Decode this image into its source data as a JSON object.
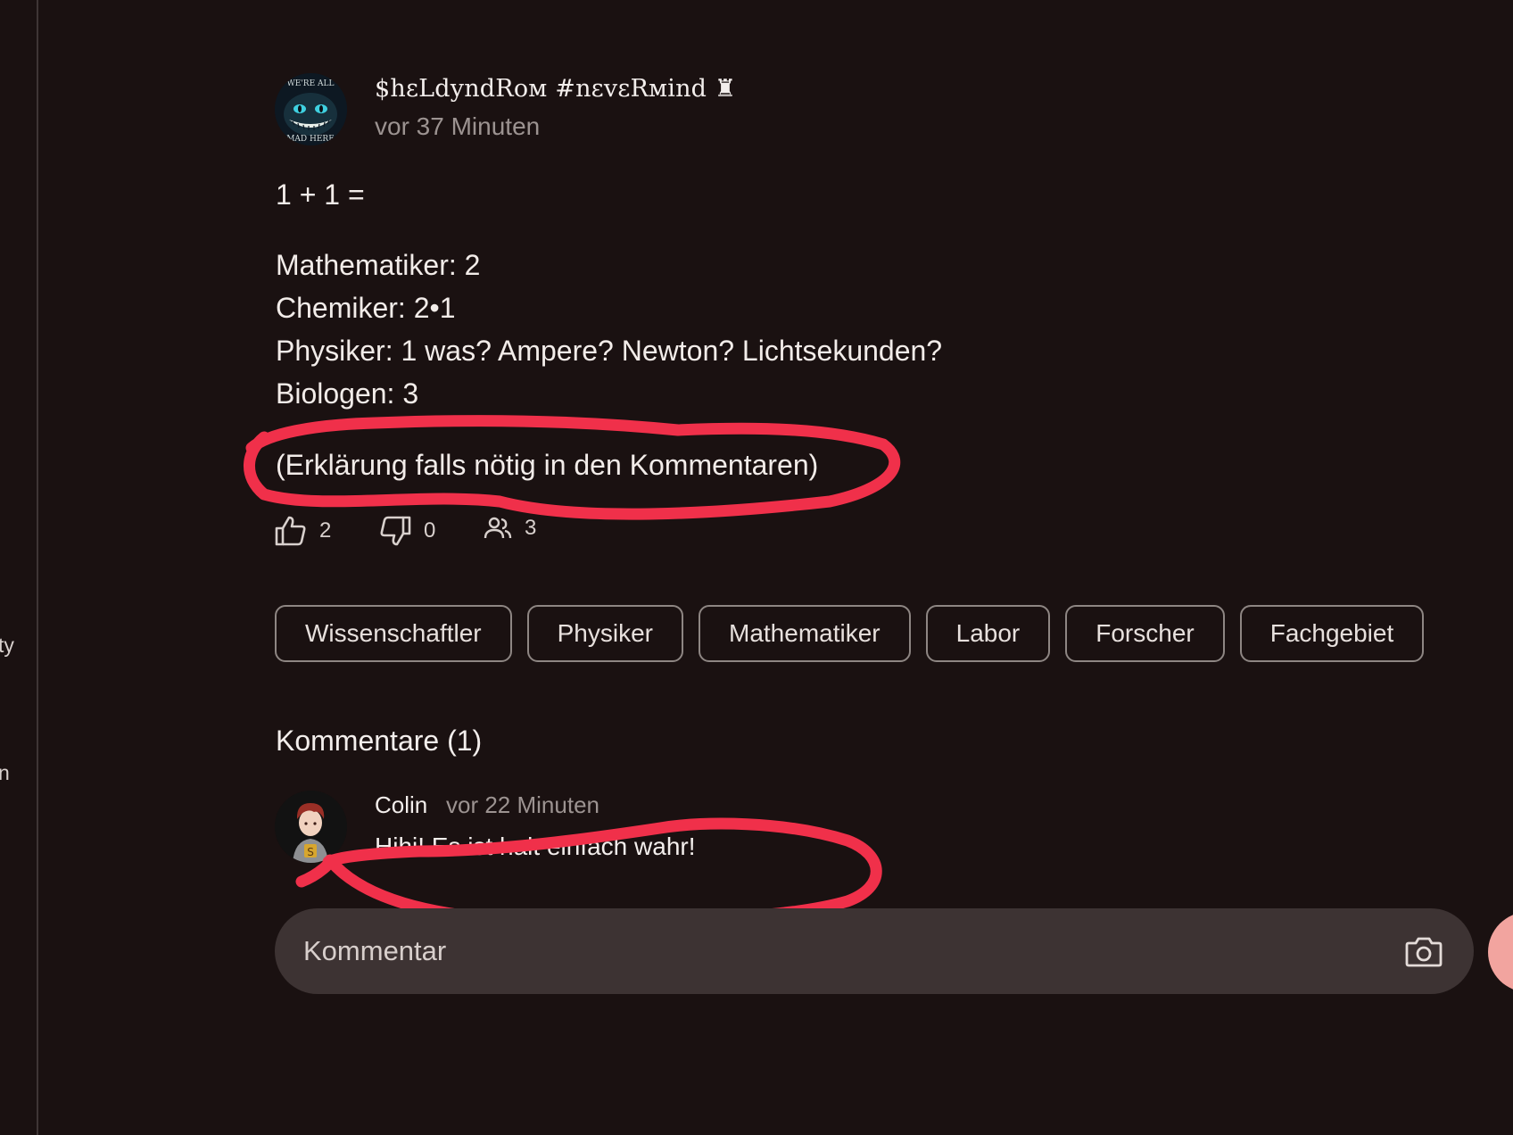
{
  "sidebar": {
    "fragments": [
      "ty",
      "n"
    ]
  },
  "post": {
    "author": "$hεLdyndRoм #nεvεRмind ♜",
    "time": "vor 37 Minuten",
    "avatar_icon": "cheshire-cat-avatar",
    "avatar_text_top": "WE'RE ALL",
    "avatar_text_bottom": "MAD HERE",
    "lines": {
      "title": "1 + 1 =",
      "math": "Mathematiker: 2",
      "chem": "Chemiker: 2•1",
      "phys": "Physiker: 1 was? Ampere? Newton? Lichtsekunden?",
      "bio": "Biologen: 3",
      "note": "(Erklärung falls nötig in den Kommentaren)"
    },
    "reactions": {
      "likes": "2",
      "dislikes": "0",
      "participants": "3"
    },
    "tags": [
      "Wissenschaftler",
      "Physiker",
      "Mathematiker",
      "Labor",
      "Forscher",
      "Fachgebiet"
    ]
  },
  "comments": {
    "heading": "Kommentare (1)",
    "items": [
      {
        "author": "Colin",
        "time": "vor 22 Minuten",
        "text": "Hihi! Es ist halt einfach wahr!"
      }
    ]
  },
  "composer": {
    "placeholder": "Kommentar",
    "camera_icon": "camera-icon"
  },
  "colors": {
    "background": "#1a1111",
    "annotation_red": "#f0304a",
    "input_bg": "#3d3333",
    "send_button": "#f2a49f"
  }
}
